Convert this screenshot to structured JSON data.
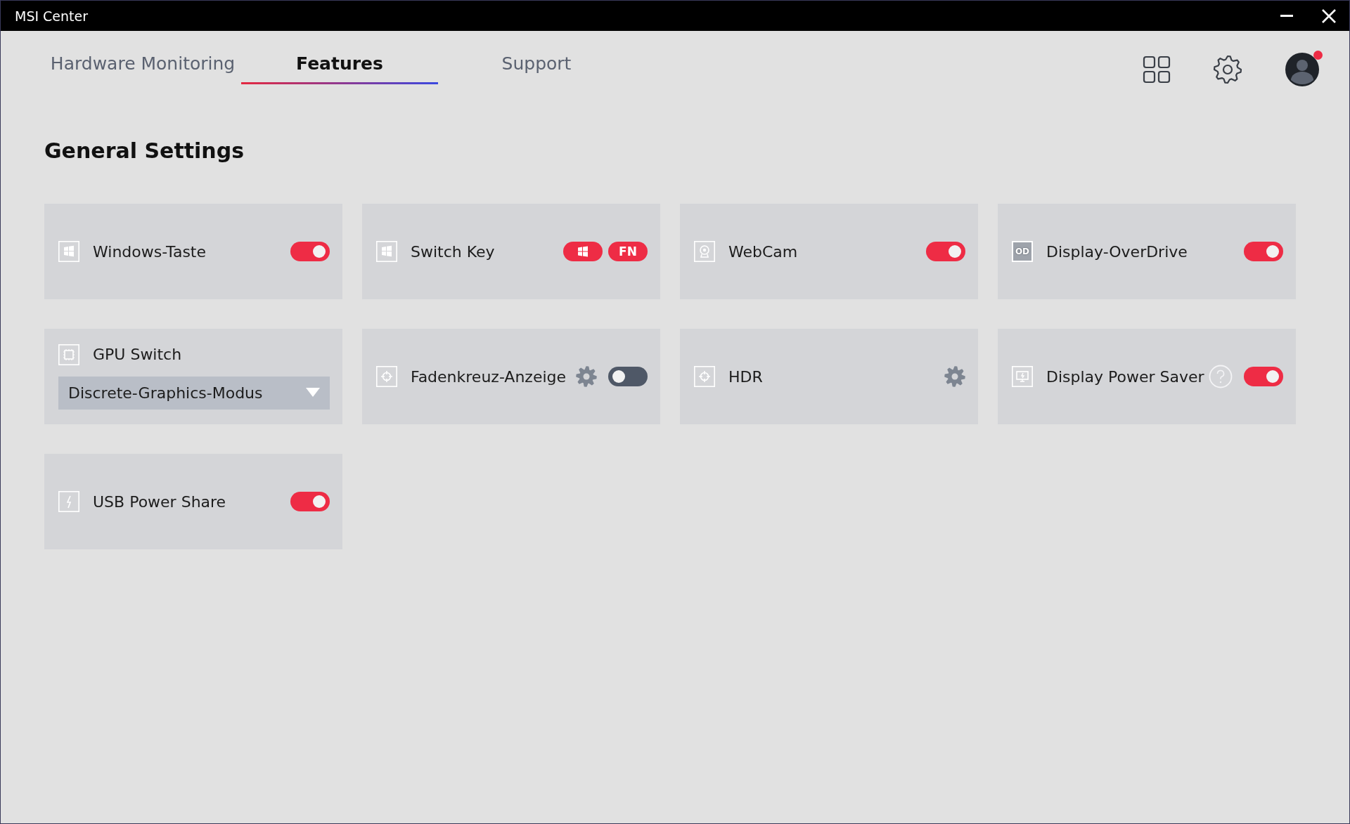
{
  "window": {
    "title": "MSI Center"
  },
  "tabs": [
    {
      "label": "Hardware Monitoring",
      "selected": false
    },
    {
      "label": "Features",
      "selected": true
    },
    {
      "label": "Support",
      "selected": false
    }
  ],
  "header_actions": {
    "notification": true
  },
  "section": {
    "title": "General Settings"
  },
  "cards": [
    {
      "kind": "toggle",
      "icon": {
        "kind": "windows"
      },
      "title": "Windows-Taste",
      "on": true
    },
    {
      "kind": "keys",
      "icon": {
        "kind": "windows"
      },
      "title": "Switch Key",
      "keys": [
        {
          "kind": "windows",
          "on": true
        },
        {
          "kind": "text",
          "label": "FN",
          "on": true
        }
      ]
    },
    {
      "kind": "toggle",
      "icon": {
        "kind": "webcam"
      },
      "title": "WebCam",
      "on": true
    },
    {
      "kind": "toggle",
      "icon": {
        "kind": "text",
        "label": "OD"
      },
      "title": "Display-OverDrive",
      "on": true
    },
    {
      "kind": "dropdown",
      "icon": {
        "kind": "chip"
      },
      "title": "GPU Switch",
      "value": "Discrete-Graphics-Modus"
    },
    {
      "kind": "gear_toggle",
      "icon": {
        "kind": "crosshair"
      },
      "title": "Fadenkreuz-Anzeige",
      "on": false
    },
    {
      "kind": "gear",
      "icon": {
        "kind": "crosshair"
      },
      "title": "HDR"
    },
    {
      "kind": "help_toggle",
      "icon": {
        "kind": "monitor"
      },
      "title": "Display Power Saver",
      "on": true
    },
    {
      "kind": "toggle",
      "icon": {
        "kind": "bolt"
      },
      "title": "USB Power Share",
      "on": true
    }
  ]
}
